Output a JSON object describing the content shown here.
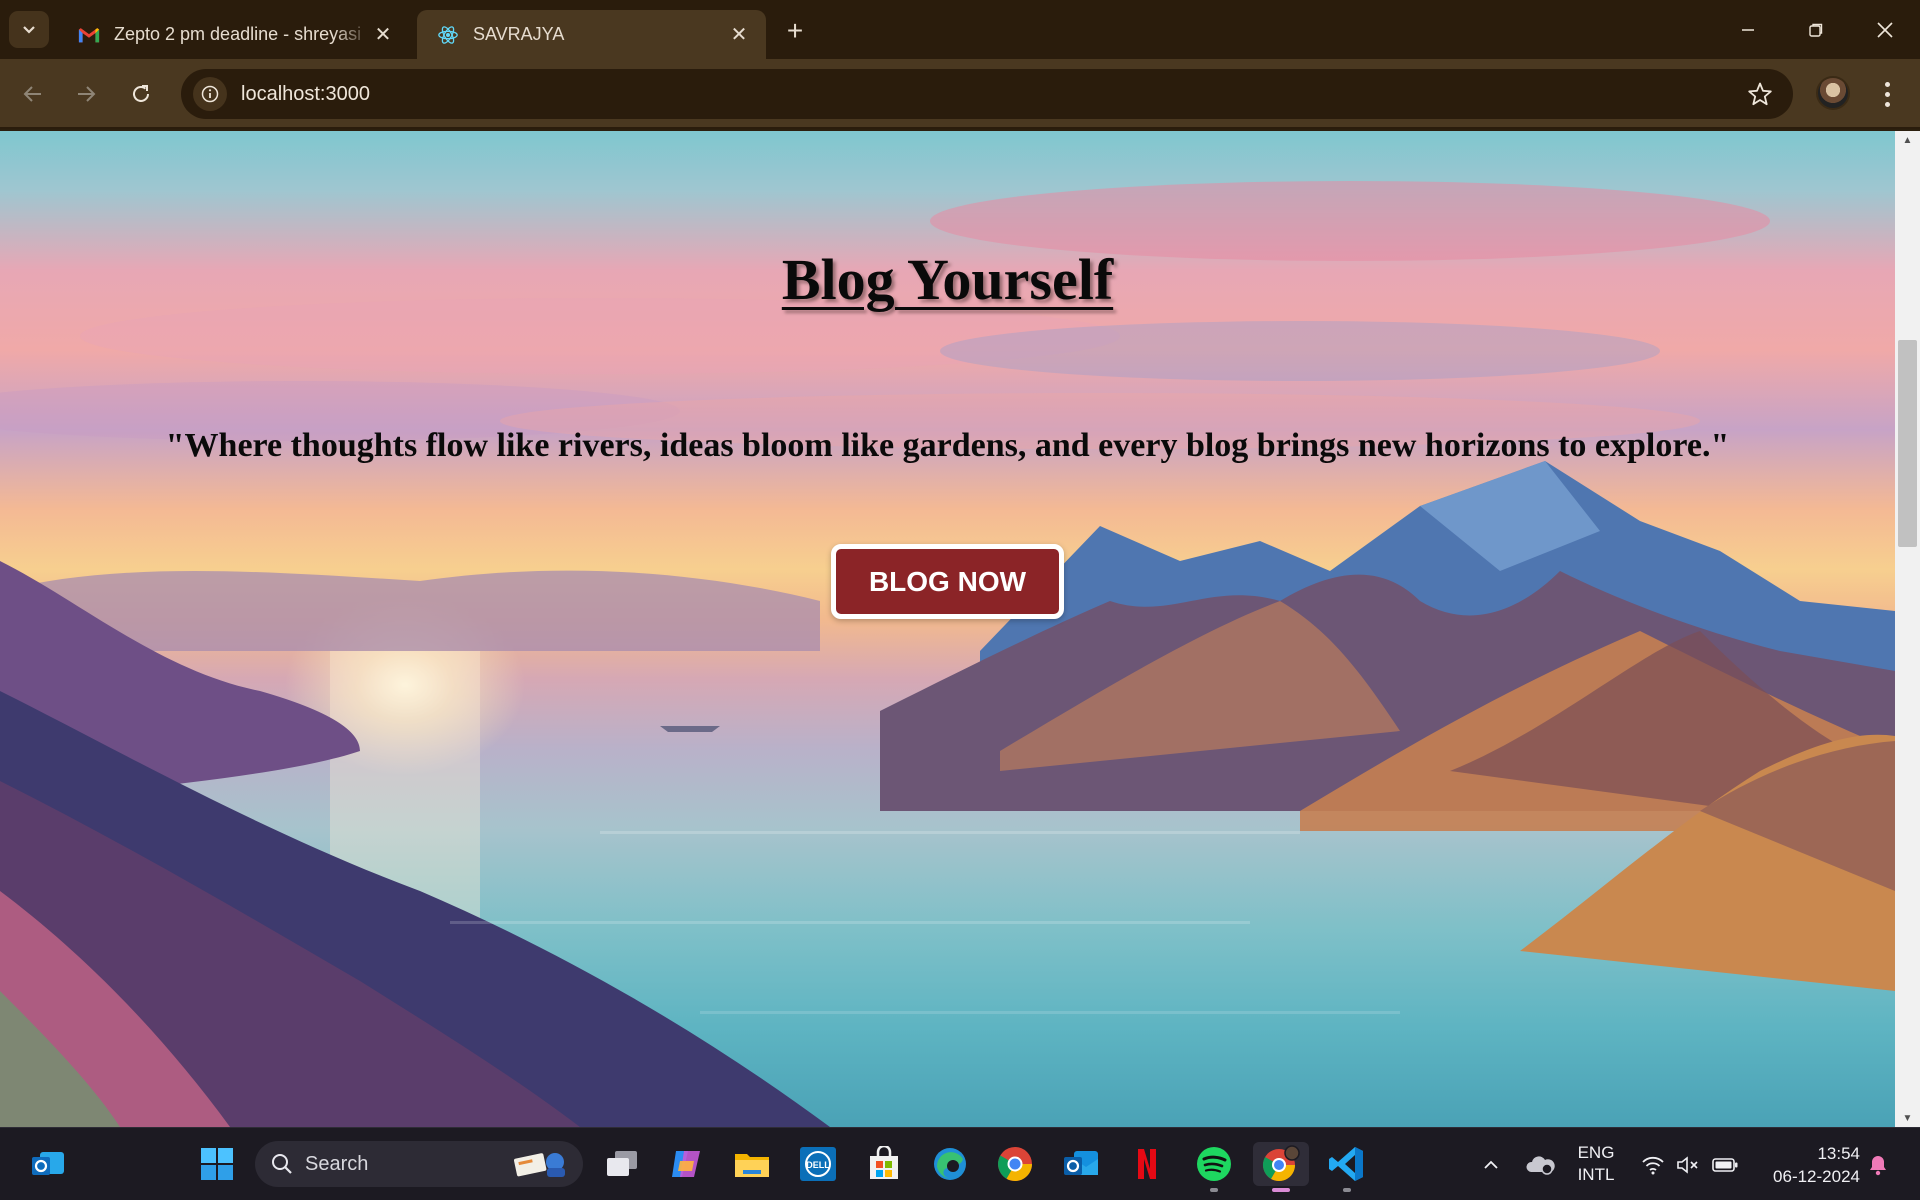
{
  "browser": {
    "tabs": [
      {
        "title": "Zepto 2 pm deadline - shreyasi",
        "favicon": "gmail-icon",
        "active": false
      },
      {
        "title": "SAVRAJYA",
        "favicon": "react-icon",
        "active": true
      }
    ],
    "url": "localhost:3000"
  },
  "page": {
    "title": "Blog Yourself",
    "quote": "\"Where thoughts flow like rivers, ideas bloom like gardens, and every blog brings new horizons to explore.\"",
    "cta_label": "BLOG NOW",
    "cta_color": "#8b2427",
    "scroll_position": 0.23
  },
  "taskbar": {
    "search_label": "Search",
    "apps": [
      "outlook-icon",
      "windows-start-icon",
      "task-view-icon",
      "copilot-icon",
      "file-explorer-icon",
      "dell-icon",
      "microsoft-store-icon",
      "edge-icon",
      "chrome-icon",
      "outlook-new-icon",
      "netflix-icon",
      "spotify-icon",
      "chrome-profile-icon",
      "vscode-icon"
    ],
    "language_top": "ENG",
    "language_bottom": "INTL",
    "time": "13:54",
    "date": "06-12-2024"
  }
}
